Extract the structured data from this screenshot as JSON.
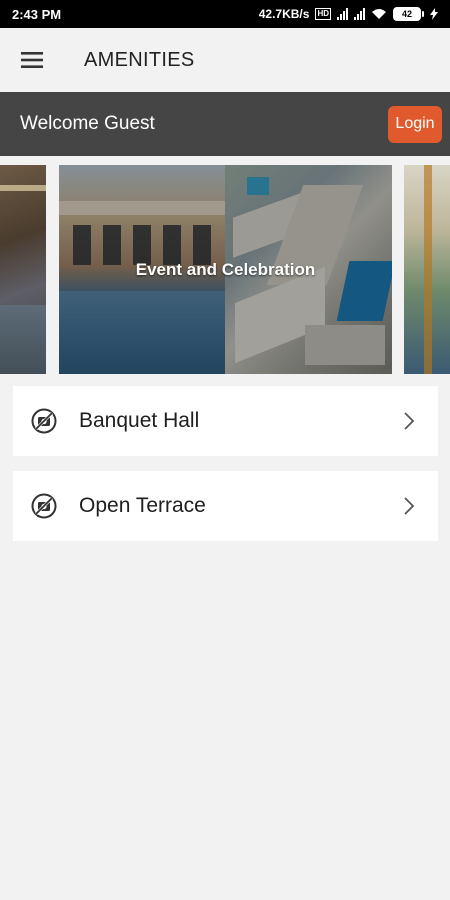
{
  "status_bar": {
    "time": "2:43 PM",
    "speed": "42.7KB/s",
    "battery": "42"
  },
  "app_bar": {
    "title": "AMENITIES",
    "menu_icon": "hamburger-menu-icon"
  },
  "welcome": {
    "text": "Welcome Guest",
    "login_label": "Login",
    "login_color": "#e05a2e"
  },
  "carousel": {
    "active_caption": "Event and Celebration"
  },
  "amenities": [
    {
      "label": "Banquet Hall",
      "icon": "no-camera-icon"
    },
    {
      "label": "Open Terrace",
      "icon": "no-camera-icon"
    }
  ]
}
